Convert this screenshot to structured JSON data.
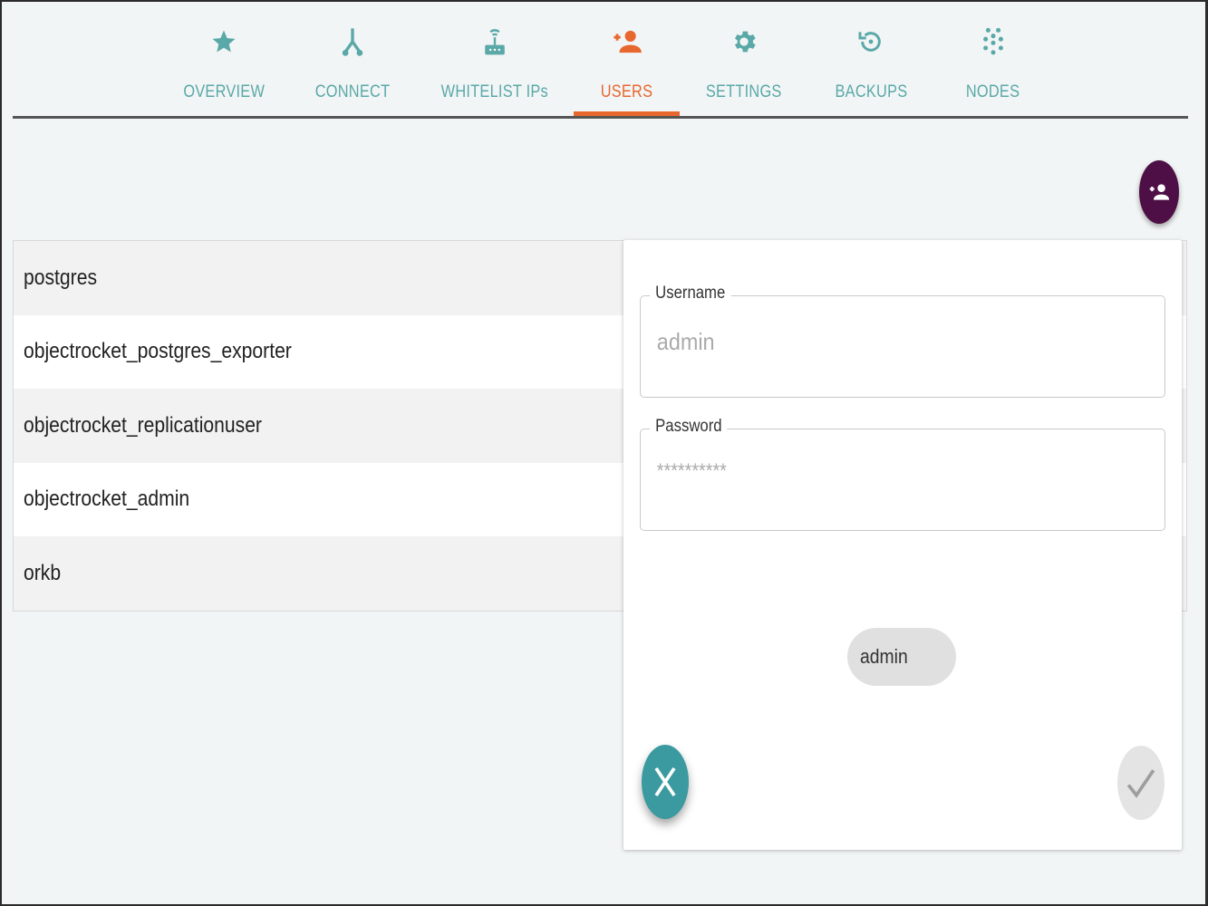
{
  "tabs": [
    {
      "label": "OVERVIEW",
      "icon": "star-icon"
    },
    {
      "label": "CONNECT",
      "icon": "connect-icon"
    },
    {
      "label": "WHITELIST IPs",
      "icon": "router-icon"
    },
    {
      "label": "USERS",
      "icon": "add-user-icon",
      "active": true
    },
    {
      "label": "SETTINGS",
      "icon": "gear-icon"
    },
    {
      "label": "BACKUPS",
      "icon": "restore-icon"
    },
    {
      "label": "NODES",
      "icon": "nodes-icon"
    }
  ],
  "users": [
    "postgres",
    "objectrocket_postgres_exporter",
    "objectrocket_replicationuser",
    "objectrocket_admin",
    "orkb"
  ],
  "dialog": {
    "username_label": "Username",
    "username_placeholder": "admin",
    "password_label": "Password",
    "password_placeholder": "**********",
    "chip_label": "admin"
  },
  "colors": {
    "accent": "#e8672f",
    "teal": "#5aa8a8",
    "fab": "#4d0f45",
    "cancel": "#3a9aa0"
  }
}
